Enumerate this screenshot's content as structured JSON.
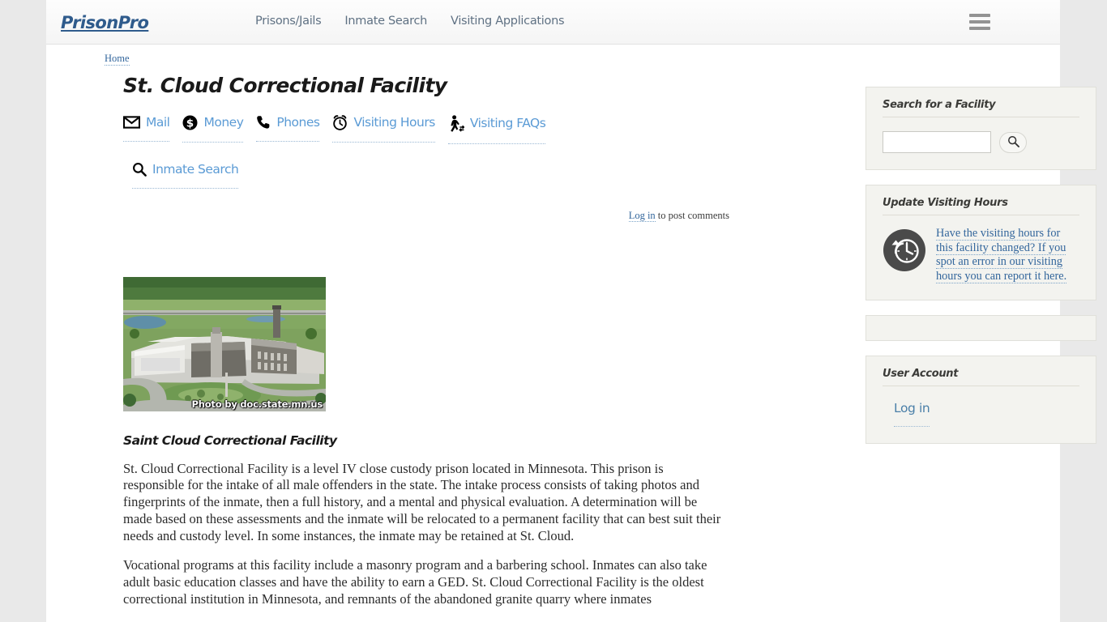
{
  "header": {
    "brand": "PrisonPro",
    "nav": [
      {
        "label": "Prisons/Jails"
      },
      {
        "label": "Inmate Search"
      },
      {
        "label": "Visiting Applications"
      }
    ],
    "menu_icon": "hamburger-menu-icon"
  },
  "breadcrumb": {
    "home": "Home"
  },
  "main": {
    "title": "St. Cloud Correctional Facility",
    "quicklinks": [
      {
        "label": "Mail",
        "icon": "mail-envelope-icon"
      },
      {
        "label": "Money",
        "icon": "money-dollar-circle-icon"
      },
      {
        "label": "Phones",
        "icon": "phone-handset-icon"
      },
      {
        "label": "Visiting Hours",
        "icon": "alarm-clock-icon"
      },
      {
        "label": "Visiting FAQs",
        "icon": "visitor-walking-icon"
      },
      {
        "label": "Inmate Search",
        "icon": "search-magnifier-icon"
      }
    ],
    "comment_link": "Log in",
    "comment_suffix": " to post comments",
    "photo_caption": "Photo by doc.state.mn.us",
    "photo_alt": "aerial-photo-of-prison-complex",
    "subtitle": "Saint Cloud Correctional Facility",
    "paragraphs": [
      "St. Cloud Correctional Facility is a level IV close custody prison located in Minnesota.  This prison is responsible for the intake of all male offenders in the state.  The intake process consists of taking photos and fingerprints of the inmate, then a full history, and a mental and physical evaluation.  A determination will be made based on these assessments and the inmate will be relocated to a permanent facility that can best suit their needs and custody level.  In some instances, the inmate may be retained at St. Cloud.",
      "Vocational programs at this facility include a masonry program and a barbering school.  Inmates can also take adult basic education classes and have the ability to earn a GED.  St. Cloud Correctional Facility is the oldest correctional institution in Minnesota, and remnants of the abandoned granite quarry where inmates"
    ]
  },
  "sidebar": {
    "search_panel": {
      "title": "Search for a Facility",
      "input_value": "",
      "input_placeholder": "",
      "button_icon": "search-magnifier-icon"
    },
    "update_panel": {
      "title": "Update Visiting Hours",
      "icon": "clock-refresh-icon",
      "link_text": "Have the visiting hours for this facility changed?  If you spot an error in our visiting hours you can report it here."
    },
    "user_panel": {
      "title": "User Account",
      "login_label": "Log in"
    }
  },
  "colors": {
    "page_background": "#e9e9e9",
    "content_background": "#ffffff",
    "brand": "#2f5b8c",
    "nav_link": "#5f7183",
    "accent_link": "#5b9bd5",
    "serif_link": "#33669c",
    "panel_background": "#f3f3ef",
    "panel_border": "#e0e0da",
    "text": "#2b2b2b"
  }
}
